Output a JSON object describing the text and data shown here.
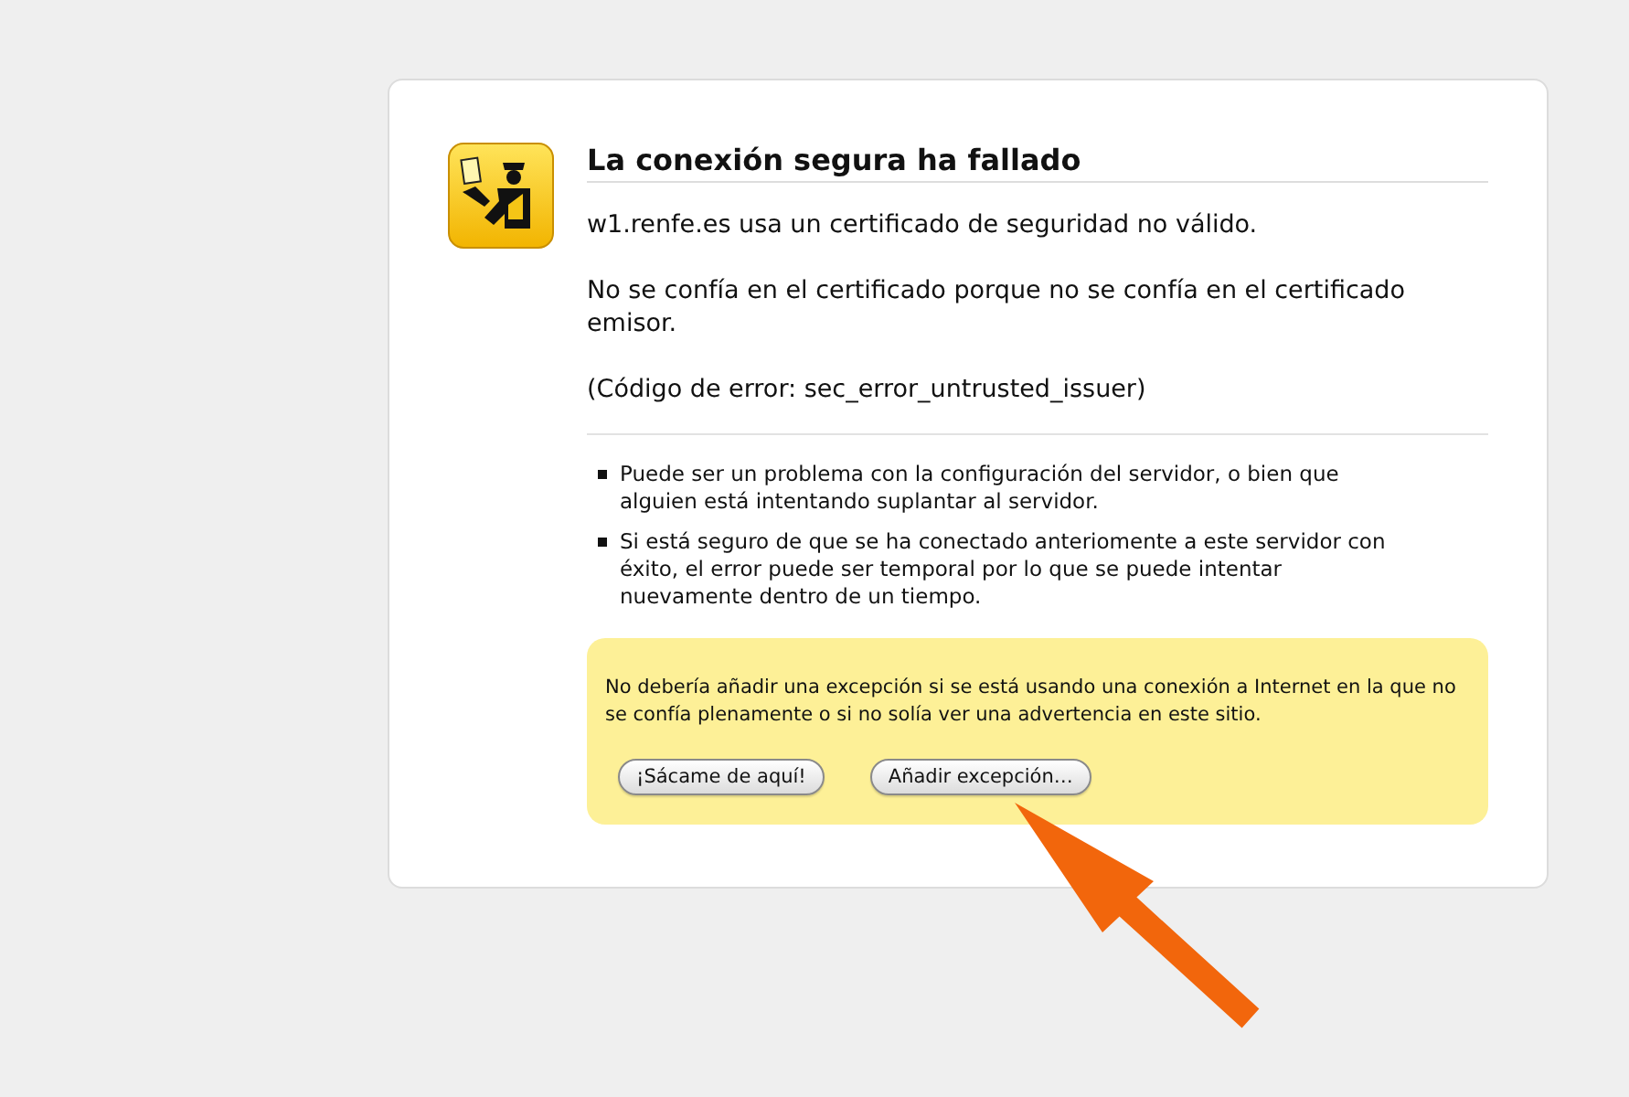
{
  "error_page": {
    "title": "La conexión segura ha fallado",
    "paragraphs": [
      "w1.renfe.es usa un certificado de seguridad no válido.",
      "No se confía en el certificado porque no se confía en el certificado emisor.",
      "(Código de error: sec_error_untrusted_issuer)"
    ],
    "details": [
      "Puede ser un problema con la configuración del servidor, o bien que alguien está intentando suplantar al servidor.",
      "Si está seguro de que se ha conectado anteriomente a este servidor con éxito, el error puede ser temporal por lo que se puede intentar nuevamente dentro de un tiempo."
    ],
    "warning": {
      "text": "No debería añadir una excepción si se está usando una conexión a Internet en la que no se confía plenamente o si no solía ver una advertencia en este sitio.",
      "buttons": [
        "¡Sácame de aquí!",
        "Añadir excepción…"
      ]
    }
  }
}
